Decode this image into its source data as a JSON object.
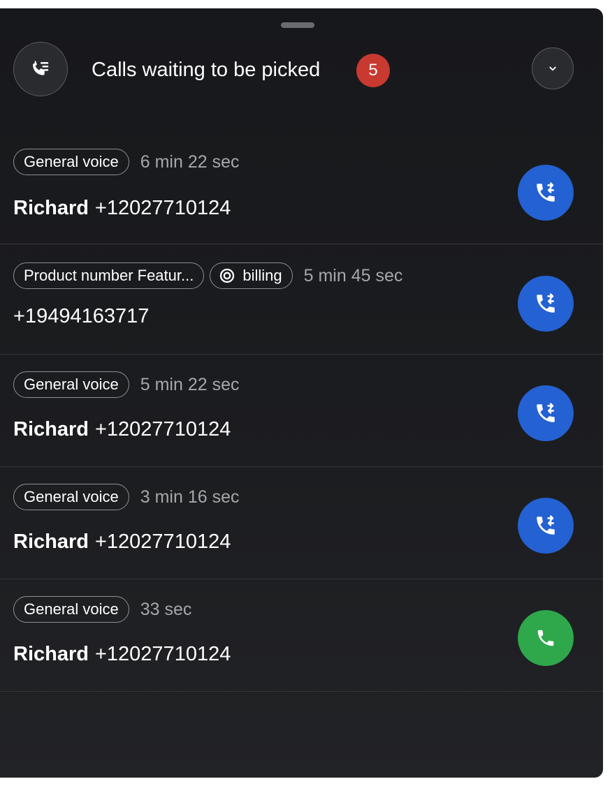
{
  "header": {
    "title": "Calls waiting to be picked",
    "count": "5",
    "queue_icon": "call-queue-icon",
    "collapse_icon": "chevron-down-icon"
  },
  "colors": {
    "panel_background": "#17181b",
    "badge": "#c8392f",
    "transfer_button": "#2461d2",
    "answer_button": "#2ea84b"
  },
  "calls": [
    {
      "tags": [
        "General voice"
      ],
      "duration": "6 min 22 sec",
      "name": "Richard",
      "number": "+12027710124",
      "action": "transfer",
      "action_icon": "phone-transfer-icon"
    },
    {
      "tags": [
        "Product number Featur..."
      ],
      "topic": "billing",
      "topic_icon": "target-icon",
      "duration": "5 min 45 sec",
      "name": "",
      "number": "+19494163717",
      "action": "transfer",
      "action_icon": "phone-transfer-icon"
    },
    {
      "tags": [
        "General voice"
      ],
      "duration": "5 min 22 sec",
      "name": "Richard",
      "number": "+12027710124",
      "action": "transfer",
      "action_icon": "phone-transfer-icon"
    },
    {
      "tags": [
        "General voice"
      ],
      "duration": "3 min 16 sec",
      "name": "Richard",
      "number": "+12027710124",
      "action": "transfer",
      "action_icon": "phone-transfer-icon"
    },
    {
      "tags": [
        "General voice"
      ],
      "duration": "33 sec",
      "name": "Richard",
      "number": "+12027710124",
      "action": "answer",
      "action_icon": "phone-icon"
    }
  ]
}
